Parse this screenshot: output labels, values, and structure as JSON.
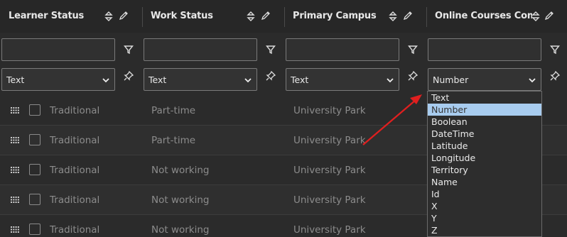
{
  "columns": [
    {
      "title": "Learner Status",
      "type": "Text"
    },
    {
      "title": "Work Status",
      "type": "Text"
    },
    {
      "title": "Primary Campus",
      "type": "Text"
    },
    {
      "title": "Online Courses Comple",
      "type": "Number"
    }
  ],
  "rows": [
    {
      "learner": "Traditional",
      "work": "Part-time",
      "campus": "University Park"
    },
    {
      "learner": "Traditional",
      "work": "Part-time",
      "campus": "University Park"
    },
    {
      "learner": "Traditional",
      "work": "Not working",
      "campus": "University Park"
    },
    {
      "learner": "Traditional",
      "work": "Not working",
      "campus": "University Park"
    },
    {
      "learner": "Traditional",
      "work": "Not working",
      "campus": "University Park"
    }
  ],
  "type_dropdown": {
    "options": [
      "Text",
      "Number",
      "Boolean",
      "DateTime",
      "Latitude",
      "Longitude",
      "Territory",
      "Name",
      "Id",
      "X",
      "Y",
      "Z"
    ],
    "selected": "Number"
  },
  "colors": {
    "annotation_arrow": "#e01f1f",
    "selected_option": "#a8ccef"
  },
  "icons": [
    "sort-icon",
    "pencil-icon",
    "filter-icon",
    "pin-icon",
    "chevron-down-icon",
    "drag-handle-icon"
  ]
}
